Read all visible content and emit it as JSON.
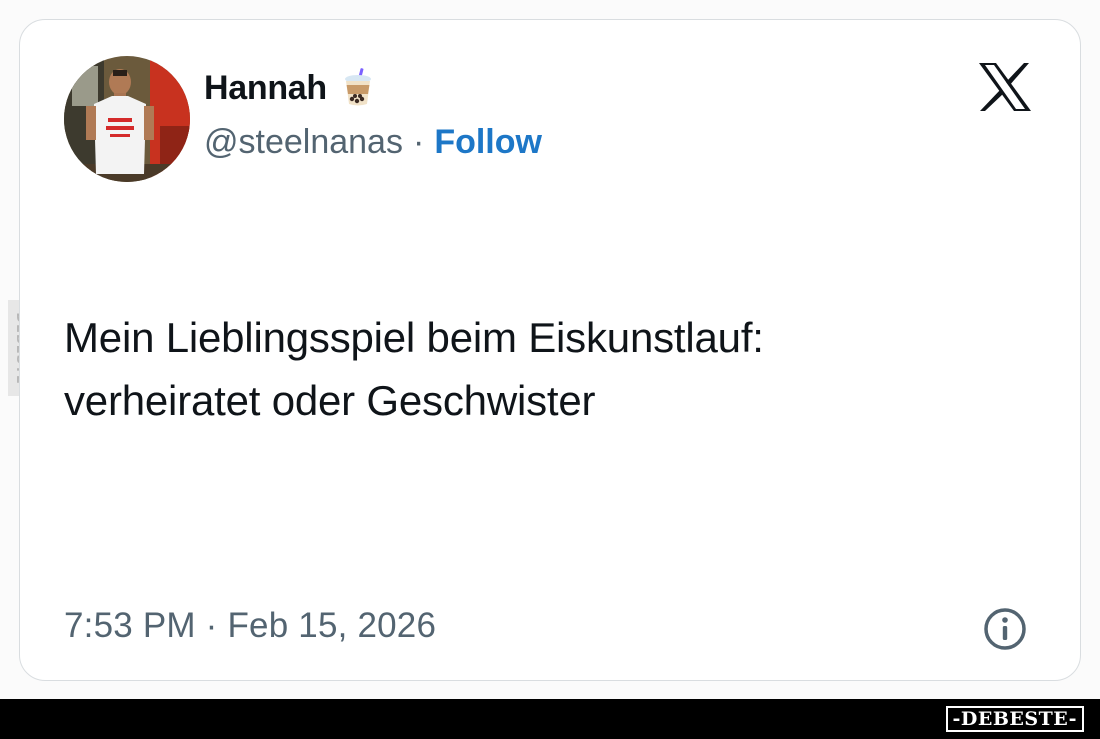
{
  "tweet": {
    "author": {
      "display_name": "Hannah",
      "name_emoji": "bubble-tea-icon",
      "handle": "@steelnanas",
      "separator": "·",
      "follow_label": "Follow"
    },
    "platform_logo": "x-logo-icon",
    "text_line1": "Mein Lieblingsspiel beim Eiskunstlauf:",
    "text_line2": "verheiratet oder Geschwister",
    "timestamp": "7:53 PM · Feb 15, 2026",
    "info_icon": "info-icon"
  },
  "watermark": {
    "side_label": "DEBESTE",
    "footer_label": "-DEBESTE-"
  },
  "colors": {
    "text_primary": "#0f1419",
    "text_secondary": "#536471",
    "link_blue": "#1d77c7",
    "card_border": "#d9dde0",
    "footer_bg": "#000000"
  }
}
